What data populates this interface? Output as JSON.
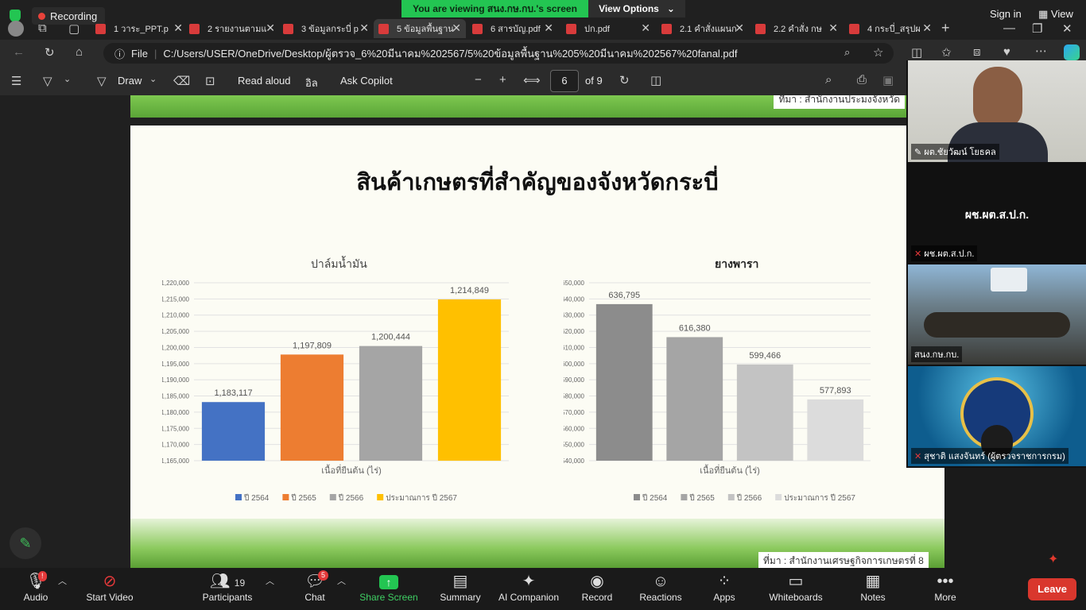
{
  "zoom_top": {
    "recording": "Recording",
    "viewing_banner": "You are viewing สนง.กษ.กบ.'s screen",
    "view_options": "View Options",
    "sign_in": "Sign in",
    "view": "View"
  },
  "browser": {
    "tabs": [
      {
        "label": "1 วาระ_PPT.p"
      },
      {
        "label": "2 รายงานตามแ"
      },
      {
        "label": "3 ข้อมูลกระบี่ p"
      },
      {
        "label": "5 ข้อมูลพื้นฐาน"
      },
      {
        "label": "6 สารบัญ.pdf"
      },
      {
        "label": "ปก.pdf"
      },
      {
        "label": "2.1 คำสั่งแผนก"
      },
      {
        "label": "2.2 คำสั่ง กษ"
      },
      {
        "label": "4 กระบี่_สรุปผ"
      }
    ],
    "file_label": "File",
    "url": "C:/Users/USER/OneDrive/Desktop/ผู้ตรวจ_6%20มีนาคม%202567/5%20ข้อมูลพื้นฐาน%205%20มีนาคม%202567%20fanal.pdf"
  },
  "pdf_toolbar": {
    "draw": "Draw",
    "read_aloud": "Read aloud",
    "lang": "อิล",
    "ask_copilot": "Ask Copilot",
    "page": "6",
    "of_pages": "of 9"
  },
  "slide": {
    "top_source": "ที่มา : สำนักงานประมงจังหวัด",
    "title": "สินค้าเกษตรที่สำคัญของจังหวัดกระบี่",
    "bottom_source": "ที่มา : สำนักงานเศรษฐกิจการเกษตรที่ 8"
  },
  "chart_data": [
    {
      "type": "bar",
      "title": "ปาล์มน้ำมัน",
      "xlabel": "เนื้อที่ยืนต้น (ไร่)",
      "categories": [
        "ปี 2564",
        "ปี 2565",
        "ปี 2566",
        "ประมาณการ ปี 2567"
      ],
      "values": [
        1183117,
        1197809,
        1200444,
        1214849
      ],
      "value_labels": [
        "1,183,117",
        "1,197,809",
        "1,200,444",
        "1,214,849"
      ],
      "colors": [
        "#4472c4",
        "#ed7d31",
        "#a5a5a5",
        "#ffc000"
      ],
      "ylim": [
        1165000,
        1220000
      ],
      "yticks": [
        "1,165,000",
        "1,170,000",
        "1,175,000",
        "1,180,000",
        "1,185,000",
        "1,190,000",
        "1,195,000",
        "1,200,000",
        "1,205,000",
        "1,210,000",
        "1,215,000",
        "1,220,000"
      ],
      "legend": [
        "ปี 2564",
        "ปี 2565",
        "ปี 2566",
        "ประมาณการ ปี 2567"
      ],
      "legend_position": "bottom",
      "grid": true
    },
    {
      "type": "bar",
      "title": "ยางพารา",
      "xlabel": "เนื้อที่ยืนต้น (ไร่)",
      "categories": [
        "ปี 2564",
        "ปี 2565",
        "ปี 2566",
        "ประมาณการ ปี 2567"
      ],
      "values": [
        636795,
        616380,
        599466,
        577893
      ],
      "value_labels": [
        "636,795",
        "616,380",
        "599,466",
        "577,893"
      ],
      "colors": [
        "#8c8c8c",
        "#a5a5a5",
        "#c3c3c3",
        "#dcdcdc"
      ],
      "ylim": [
        540000,
        650000
      ],
      "yticks": [
        "540,000",
        "550,000",
        "560,000",
        "570,000",
        "580,000",
        "590,000",
        "600,000",
        "610,000",
        "620,000",
        "630,000",
        "640,000",
        "650,000"
      ],
      "legend": [
        "ปี 2564",
        "ปี 2565",
        "ปี 2566",
        "ประมาณการ ปี 2567"
      ],
      "legend_position": "bottom",
      "grid": true
    }
  ],
  "video_tiles": [
    {
      "name": "ผต.ชัยวัฒน์ โยธคล"
    },
    {
      "name": "ผช.ผต.ส.ป.ก.",
      "center_label": "ผช.ผต.ส.ป.ก."
    },
    {
      "name": "สนง.กษ.กบ."
    },
    {
      "name": "สุชาติ แสงจันทร์ (ผู้ตรวจราชการกรม)"
    }
  ],
  "zoom_bar": {
    "audio": "Audio",
    "start_video": "Start Video",
    "participants": "Participants",
    "participants_count": "19",
    "chat": "Chat",
    "chat_badge": "5",
    "share_screen": "Share Screen",
    "summary": "Summary",
    "ai_companion": "AI Companion",
    "record": "Record",
    "reactions": "Reactions",
    "apps": "Apps",
    "whiteboards": "Whiteboards",
    "notes": "Notes",
    "more": "More",
    "leave": "Leave"
  }
}
